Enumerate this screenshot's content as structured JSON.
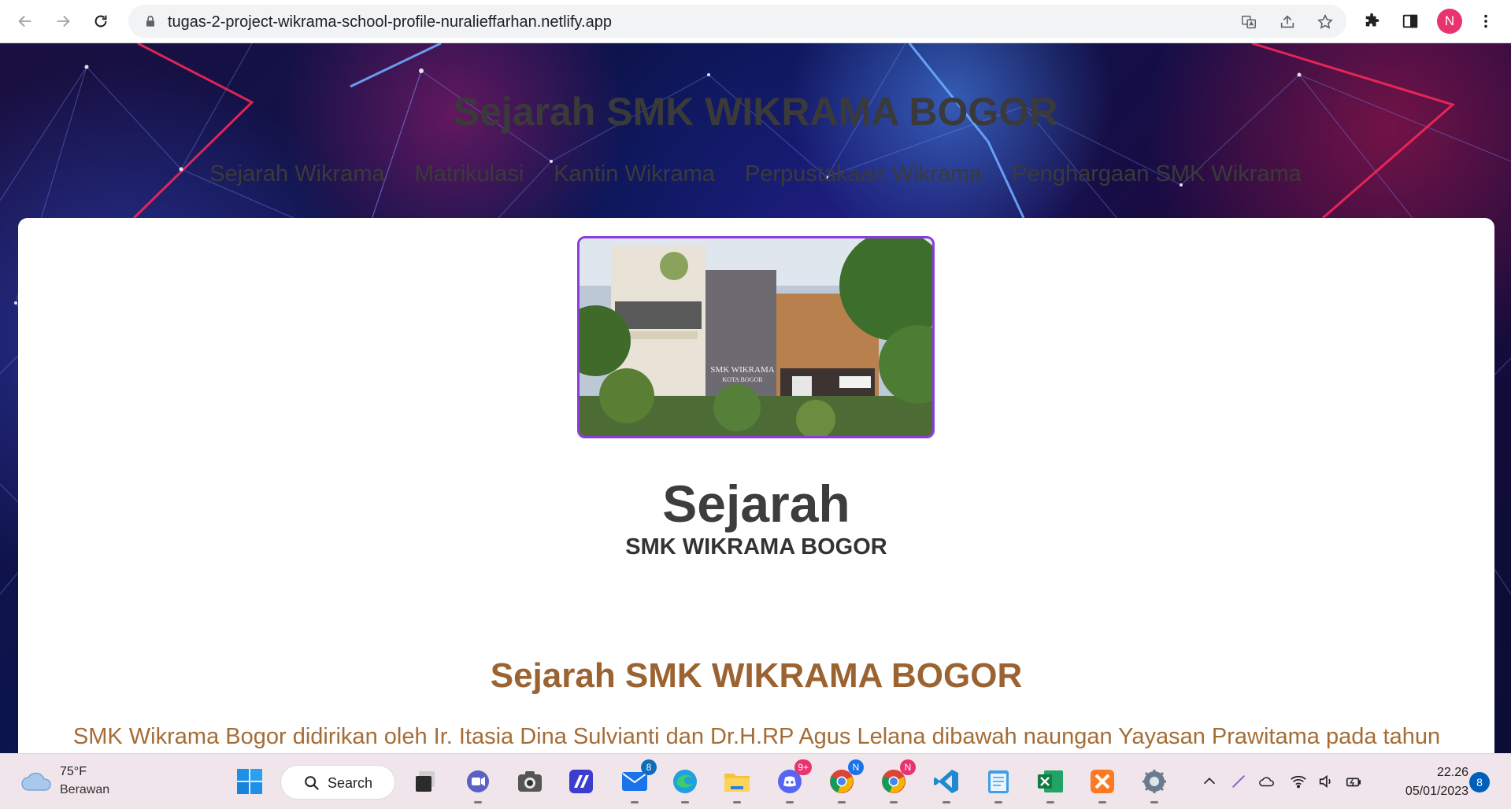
{
  "browser": {
    "url": "tugas-2-project-wikrama-school-profile-nuralieffarhan.netlify.app",
    "profile_initial": "N"
  },
  "site": {
    "title": "Sejarah SMK WIKRAMA BOGOR",
    "nav": [
      "Sejarah Wikrama",
      "Matrikulasi",
      "Kantin Wikrama",
      "Perpustakaan Wikrama",
      "Penghargaan SMK Wikrama"
    ]
  },
  "content": {
    "photo_sign_line1": "SMK WIKRAMA",
    "photo_sign_line2": "KOTA BOGOR",
    "heading": "Sejarah",
    "subheading": "SMK WIKRAMA BOGOR",
    "section_title": "Sejarah SMK WIKRAMA BOGOR",
    "paragraph": "SMK Wikrama Bogor didirikan oleh Ir. Itasia Dina Sulvianti dan Dr.H.RP Agus Lelana dibawah naungan Yayasan Prawitama pada tahun"
  },
  "taskbar": {
    "weather_temp": "75°F",
    "weather_condition": "Berawan",
    "search_label": "Search",
    "mail_badge": "8",
    "discord_badge": "9+",
    "chrome1_badge": "N",
    "chrome2_badge": "N",
    "time": "22.26",
    "date": "05/01/2023",
    "notification_count": "8"
  },
  "colors": {
    "accent_purple": "#8b3ddb",
    "section_brown": "#9a6331"
  }
}
